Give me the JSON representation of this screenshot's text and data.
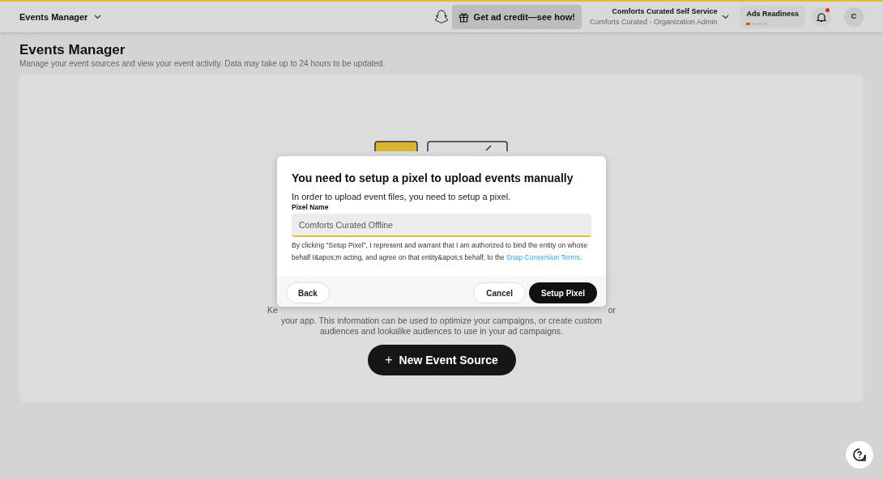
{
  "header": {
    "app_menu": "Events Manager",
    "promo_button": "Get ad credit—see how!",
    "account": {
      "name": "Comforts Curated Self Service",
      "role": "Comforts Curated - Organization Admin"
    },
    "ads_readiness": {
      "label": "Ads Readiness",
      "level": 0.25
    },
    "notifications": {
      "unread": true
    },
    "avatar": "C"
  },
  "page": {
    "title": "Events Manager",
    "subtitle": "Manage your event sources and view your event activity. Data may take up to 24 hours to be updated."
  },
  "card": {
    "description_fragments": [
      "Ke",
      "or"
    ],
    "description_lines": [
      "your app. This information can be used to optimize your campaigns, or create custom",
      "audiences and lookalike audiences to use in your ad campaigns."
    ],
    "new_source_button": {
      "icon": "+",
      "label": "New Event Source"
    }
  },
  "dialog": {
    "title": "You need to setup a pixel to upload events manually",
    "message": "In order to upload event files, you need to setup a pixel.",
    "field_label": "Pixel Name",
    "field_value": "Comforts Curated Offline",
    "legal_text": "By clicking \"Setup Pixel\", I represent and warrant that I am authorized to bind the entity on whose behalf I&apos;m acting, and agree on that entity&apos;s behalf, to the",
    "legal_link": "Snap Conversion Terms",
    "legal_end": ".",
    "back_button": "Back",
    "cancel_button": "Cancel",
    "confirm_button": "Setup Pixel"
  }
}
